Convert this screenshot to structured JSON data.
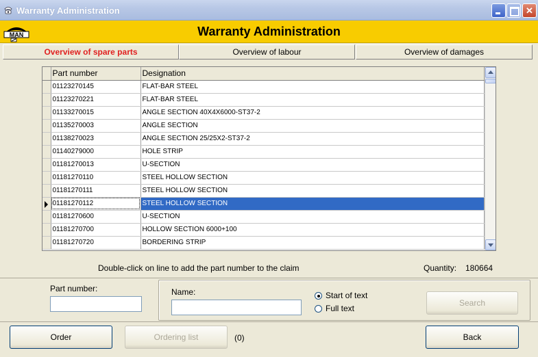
{
  "window": {
    "title": "Warranty Administration"
  },
  "header": {
    "title": "Warranty Administration",
    "logo_text": "MAN"
  },
  "tabs": [
    {
      "label": "Overview of spare parts",
      "active": true
    },
    {
      "label": "Overview of labour",
      "active": false
    },
    {
      "label": "Overview of damages",
      "active": false
    }
  ],
  "grid": {
    "columns": [
      "Part number",
      "Designation"
    ],
    "rows": [
      [
        "01123270145",
        "FLAT-BAR STEEL"
      ],
      [
        "01123270221",
        "FLAT-BAR STEEL"
      ],
      [
        "01133270015",
        "ANGLE SECTION 40X4X6000-ST37-2"
      ],
      [
        "01135270003",
        "ANGLE SECTION"
      ],
      [
        "01138270023",
        "ANGLE SECTION 25/25X2-ST37-2"
      ],
      [
        "01140279000",
        "HOLE STRIP"
      ],
      [
        "01181270013",
        "U-SECTION"
      ],
      [
        "01181270110",
        "STEEL HOLLOW SECTION"
      ],
      [
        "01181270111",
        "STEEL HOLLOW SECTION"
      ],
      [
        "01181270112",
        "STEEL HOLLOW SECTION"
      ],
      [
        "01181270600",
        "U-SECTION"
      ],
      [
        "01181270700",
        "HOLLOW SECTION 6000+100"
      ],
      [
        "01181270720",
        "BORDERING STRIP"
      ]
    ],
    "selected_row": 9
  },
  "hint": "Double-click on line to add the part number to the claim",
  "quantity": {
    "label": "Quantity:",
    "value": "180664"
  },
  "search": {
    "part_number_label": "Part number:",
    "part_number_value": "",
    "name_label": "Name:",
    "name_value": "",
    "options": [
      {
        "label": "Start of text",
        "checked": true
      },
      {
        "label": "Full text",
        "checked": false
      }
    ],
    "search_button": "Search"
  },
  "bottom": {
    "order_button": "Order",
    "ordering_list_button": "Ordering list",
    "ordering_count": "(0)",
    "back_button": "Back"
  },
  "colors": {
    "header_bg": "#f8cc00",
    "active_tab_text": "#e02020",
    "selection": "#316ac5"
  }
}
